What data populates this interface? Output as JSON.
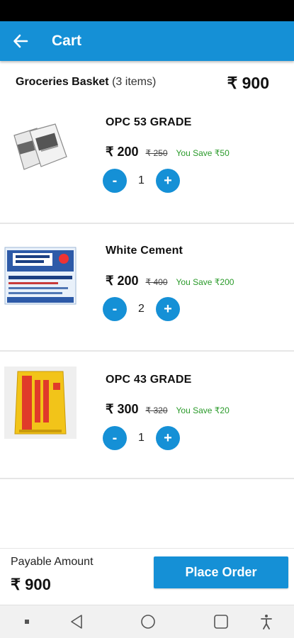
{
  "app_bar": {
    "title": "Cart"
  },
  "basket": {
    "name": "Groceries Basket",
    "count": "(3 items)",
    "total": "₹ 900"
  },
  "items": [
    {
      "name": "OPC 53 GRADE",
      "price": "₹ 200",
      "mrp": "₹ 250",
      "save": "You Save ₹50",
      "qty": "1"
    },
    {
      "name": "White Cement",
      "price": "₹ 200",
      "mrp": "₹ 400",
      "save": "You Save ₹200",
      "qty": "2"
    },
    {
      "name": "OPC 43 GRADE",
      "price": "₹ 300",
      "mrp": "₹ 320",
      "save": "You Save ₹20",
      "qty": "1"
    }
  ],
  "qty_controls": {
    "minus": "-",
    "plus": "+"
  },
  "footer": {
    "payable_label": "Payable Amount",
    "payable_amount": "₹ 900",
    "place_order": "Place Order"
  },
  "icons": {
    "back": "arrow-left-icon",
    "nav_back": "triangle-back-icon",
    "nav_home": "circle-home-icon",
    "nav_recent": "square-recent-icon",
    "accessibility": "accessibility-icon",
    "nav_dot": "dot-icon"
  },
  "colors": {
    "primary": "#1590d6",
    "save_green": "#2a9a2a"
  }
}
